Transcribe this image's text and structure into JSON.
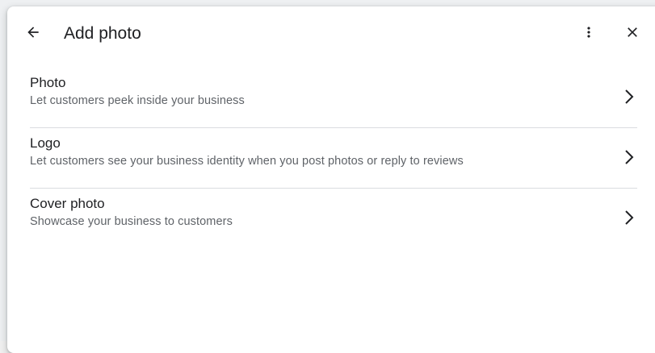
{
  "dialog": {
    "title": "Add photo",
    "icons": {
      "back": "arrow-back-icon",
      "more": "more-vert-icon",
      "close": "close-icon"
    }
  },
  "options": [
    {
      "title": "Photo",
      "subtitle": "Let customers peek inside your business"
    },
    {
      "title": "Logo",
      "subtitle": "Let customers see your business identity when you post photos or reply to reviews"
    },
    {
      "title": "Cover photo",
      "subtitle": "Showcase your business to customers"
    }
  ],
  "colors": {
    "title_text": "#202124",
    "secondary_text": "#5f6368",
    "divider": "#dadce0"
  }
}
